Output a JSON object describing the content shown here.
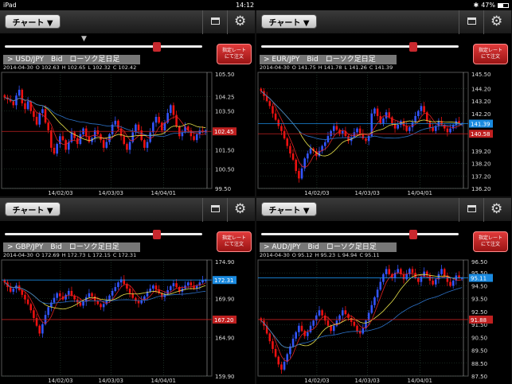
{
  "status_bar": {
    "device": "iPad",
    "time": "14:12",
    "battery": "47%"
  },
  "colors": {
    "up": "#3355ff",
    "down": "#ee1111",
    "ma_short": "#dd2222",
    "ma_mid": "#e8e24a",
    "ma_long": "#2d72c8",
    "grid": "#2d4d3a",
    "price_tag_bid": "#1a8ae0",
    "price_tag_ask": "#c02020"
  },
  "panels": [
    {
      "chart_button": "チャート ▼",
      "order_button": [
        "指定レート",
        "にて注文"
      ],
      "pair_label": "> USD/JPY　Bid　ローソク足日足",
      "date": "2014-04-30",
      "open": "102.63",
      "high": "102.65",
      "low": "102.32",
      "close": "102.42",
      "axis_top": "105.50",
      "y_ticks": [
        "104.25",
        "103.50",
        "101.50",
        "100.50",
        "99.50"
      ],
      "price_tag": "102.45",
      "x_ticks": [
        "14/02/03",
        "14/03/03",
        "14/04/01"
      ],
      "ymin": 99.5,
      "ymax": 105.5,
      "series": [
        104.2,
        104.1,
        104.0,
        103.8,
        104.3,
        104.6,
        103.9,
        103.6,
        104.0,
        103.5,
        103.2,
        102.8,
        103.4,
        103.6,
        102.9,
        102.5,
        101.6,
        101.3,
        101.8,
        102.2,
        102.0,
        101.5,
        101.9,
        102.4,
        102.1,
        101.8,
        102.3,
        102.6,
        102.2,
        101.9,
        102.1,
        102.5,
        102.3,
        102.0,
        101.6,
        101.9,
        102.3,
        102.8,
        103.0,
        102.6,
        102.2,
        101.8,
        101.5,
        101.9,
        102.4,
        102.8,
        102.5,
        102.0,
        101.6,
        101.9,
        102.4,
        102.9,
        103.2,
        102.9,
        102.5,
        102.9,
        103.4,
        103.8,
        103.3,
        102.7,
        102.2,
        102.4,
        102.7,
        102.5,
        102.2,
        102.0,
        102.3,
        102.5,
        102.4,
        102.5
      ],
      "slider": 0.77,
      "show_marker": true
    },
    {
      "chart_button": "チャート ▼",
      "order_button": [
        "指定レート",
        "にて注文"
      ],
      "pair_label": "> EUR/JPY　Bid　ローソク足日足",
      "date": "2014-04-30",
      "open": "141.75",
      "high": "141.78",
      "low": "141.26",
      "close": "141.39",
      "axis_top": "145.50",
      "y_ticks": [
        "144.20",
        "143.20",
        "142.20",
        "139.20",
        "138.20",
        "137.20",
        "136.20"
      ],
      "price_tag": "141.39",
      "price_tag2": "140.58",
      "x_ticks": [
        "14/02/03",
        "14/03/03",
        "14/04/01"
      ],
      "ymin": 136.2,
      "ymax": 145.5,
      "series": [
        144.0,
        143.6,
        143.2,
        142.8,
        142.2,
        141.7,
        141.2,
        140.8,
        140.2,
        139.6,
        139.0,
        138.5,
        137.6,
        137.0,
        137.8,
        138.6,
        139.0,
        139.4,
        139.2,
        138.8,
        139.2,
        139.6,
        139.9,
        140.4,
        140.8,
        141.2,
        140.9,
        140.6,
        140.8,
        140.4,
        140.0,
        140.3,
        140.7,
        141.0,
        140.6,
        140.2,
        140.0,
        140.4,
        142.2,
        142.6,
        142.0,
        141.4,
        141.8,
        142.3,
        141.9,
        141.4,
        141.0,
        141.3,
        141.6,
        141.2,
        140.8,
        141.1,
        141.5,
        142.0,
        142.4,
        142.8,
        142.3,
        141.6,
        141.1,
        140.8,
        141.2,
        141.6,
        141.3,
        141.0,
        140.7,
        141.0,
        141.3,
        141.6,
        141.4,
        141.4
      ],
      "slider": 0.77,
      "show_marker": false
    },
    {
      "chart_button": "チャート ▼",
      "order_button": [
        "指定レート",
        "にて注文"
      ],
      "pair_label": "> GBP/JPY　Bid　ローソク足日足",
      "date": "2014-04-30",
      "open": "172.69",
      "high": "172.73",
      "low": "172.15",
      "close": "172.31",
      "axis_top": "174.90",
      "y_ticks": [
        "169.90",
        "164.90",
        "159.90"
      ],
      "price_tag": "172.31",
      "price_tag2": "167.20",
      "x_ticks": [
        "14/02/03",
        "14/03/03",
        "14/04/01"
      ],
      "ymin": 159.9,
      "ymax": 174.9,
      "series": [
        172.0,
        171.4,
        170.8,
        171.2,
        171.6,
        171.0,
        170.4,
        169.8,
        169.2,
        168.4,
        167.4,
        166.4,
        165.4,
        166.6,
        167.8,
        168.8,
        169.4,
        170.0,
        170.6,
        170.2,
        169.8,
        170.4,
        170.9,
        170.3,
        169.8,
        169.4,
        169.0,
        169.5,
        170.1,
        170.6,
        170.2,
        169.6,
        169.2,
        168.8,
        169.2,
        169.7,
        170.3,
        170.9,
        171.4,
        172.0,
        172.4,
        171.8,
        171.2,
        170.6,
        170.0,
        169.6,
        169.3,
        169.7,
        170.2,
        170.8,
        171.2,
        171.6,
        171.1,
        170.6,
        170.1,
        170.5,
        171.0,
        171.5,
        171.9,
        171.4,
        170.8,
        171.2,
        171.6,
        172.0,
        171.6,
        171.2,
        171.6,
        172.0,
        172.3,
        172.3
      ],
      "slider": 0.77,
      "show_marker": false
    },
    {
      "chart_button": "チャート ▼",
      "order_button": [
        "指定レート",
        "にて注文"
      ],
      "pair_label": "> AUD/JPY　Bid　ローソク足日足",
      "date": "2014-04-30",
      "open": "95.12",
      "high": "95.23",
      "low": "94.94",
      "close": "95.11",
      "axis_top": "96.50",
      "y_ticks": [
        "95.50",
        "94.50",
        "93.50",
        "92.50",
        "91.50",
        "90.50",
        "89.50",
        "88.50",
        "87.50"
      ],
      "price_tag": "95.11",
      "price_tag2": "91.88",
      "x_ticks": [
        "14/02/03",
        "14/03/03",
        "14/04/01"
      ],
      "ymin": 87.5,
      "ymax": 96.5,
      "series": [
        91.8,
        91.4,
        90.8,
        90.2,
        89.6,
        89.0,
        88.4,
        88.0,
        88.6,
        89.2,
        89.8,
        90.4,
        90.9,
        91.4,
        91.0,
        90.6,
        90.9,
        91.4,
        91.8,
        92.2,
        92.6,
        92.2,
        91.8,
        91.4,
        91.0,
        91.4,
        91.8,
        92.2,
        92.6,
        92.3,
        92.0,
        91.7,
        91.4,
        91.0,
        90.8,
        91.2,
        91.8,
        92.4,
        93.0,
        93.6,
        94.2,
        94.8,
        95.4,
        95.8,
        95.4,
        95.1,
        95.5,
        95.8,
        95.4,
        95.0,
        95.4,
        95.8,
        95.5,
        95.1,
        94.8,
        95.2,
        95.6,
        95.3,
        94.9,
        94.6,
        95.0,
        95.4,
        95.8,
        95.3,
        94.8,
        94.5,
        94.9,
        95.3,
        95.1,
        95.1
      ],
      "slider": 0.77,
      "show_marker": false
    }
  ]
}
